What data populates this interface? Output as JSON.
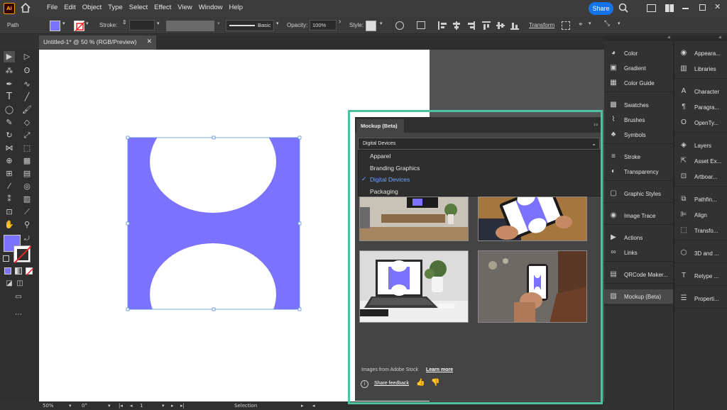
{
  "app": {
    "logo": "Ai",
    "menu": [
      "File",
      "Edit",
      "Object",
      "Type",
      "Select",
      "Effect",
      "View",
      "Window",
      "Help"
    ],
    "share_label": "Share"
  },
  "control": {
    "path_label": "Path",
    "stroke_label": "Stroke:",
    "stroke_style": "Basic",
    "opacity_label": "Opacity:",
    "opacity_value": "100%",
    "style_label": "Style:",
    "transform_label": "Transform"
  },
  "colors": {
    "fill": "#7b73ff",
    "accent": "#1473e6",
    "highlight": "#4fc3a1"
  },
  "document": {
    "tab_title": "Untitled-1* @ 50 % (RGB/Preview)"
  },
  "status": {
    "zoom": "50%",
    "rotation": "0°",
    "artboard": "1",
    "tool": "Selection"
  },
  "panels": {
    "col1": [
      [
        "Color",
        "Gradient",
        "Color Guide"
      ],
      [
        "Swatches",
        "Brushes",
        "Symbols"
      ],
      [
        "Stroke",
        "Transparency"
      ],
      [
        "Graphic Styles"
      ],
      [
        "Image Trace"
      ],
      [
        "Actions",
        "Links"
      ],
      [
        "QRCode Maker..."
      ],
      [
        "Mockup (Beta)"
      ]
    ],
    "col2": [
      [
        "Appeara...",
        "Libraries"
      ],
      [
        "Character",
        "Paragra...",
        "OpenTy..."
      ],
      [
        "Layers",
        "Asset Ex...",
        "Artboar..."
      ],
      [
        "Pathfin...",
        "Align",
        "Transfo..."
      ],
      [
        "3D and ..."
      ],
      [
        "Retype ..."
      ],
      [
        "Properti..."
      ]
    ]
  },
  "mockup": {
    "tab": "Mockup (Beta)",
    "selected_category": "Digital Devices",
    "options": [
      "Apparel",
      "Branding Graphics",
      "Digital Devices",
      "Packaging"
    ],
    "footer_text": "Images from Adobe Stock",
    "learn_more": "Learn more",
    "share_feedback": "Share feedback"
  }
}
